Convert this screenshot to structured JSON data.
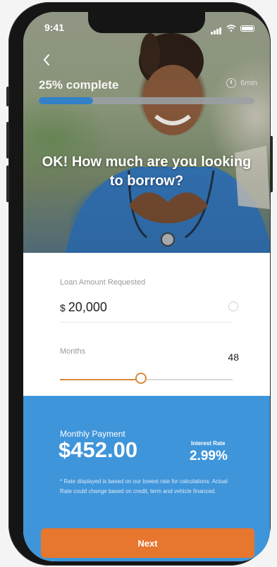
{
  "status_bar": {
    "time": "9:41"
  },
  "progress": {
    "label": "25% complete",
    "fraction": 0.25,
    "time_left": "6min"
  },
  "headline": "OK! How much are you looking to borrow?",
  "loan": {
    "label": "Loan Amount Requested",
    "currency": "$",
    "value": "20,000"
  },
  "months": {
    "label": "Months",
    "value": "48",
    "slider_fraction": 0.47
  },
  "payment": {
    "label": "Monthly Payment",
    "value": "$452.00",
    "rate_label": "Interest Rate",
    "rate_value": "2.99%",
    "disclaimer": "* Rate displayed is based on our lowest rate for calculations. Actual Rate could change based on credit, term and vehicle financed."
  },
  "next_button": "Next",
  "colors": {
    "accent_orange": "#e7762e",
    "panel_blue": "#3f95da",
    "progress_blue": "#2c7fd1",
    "slider_orange": "#d88a38"
  }
}
